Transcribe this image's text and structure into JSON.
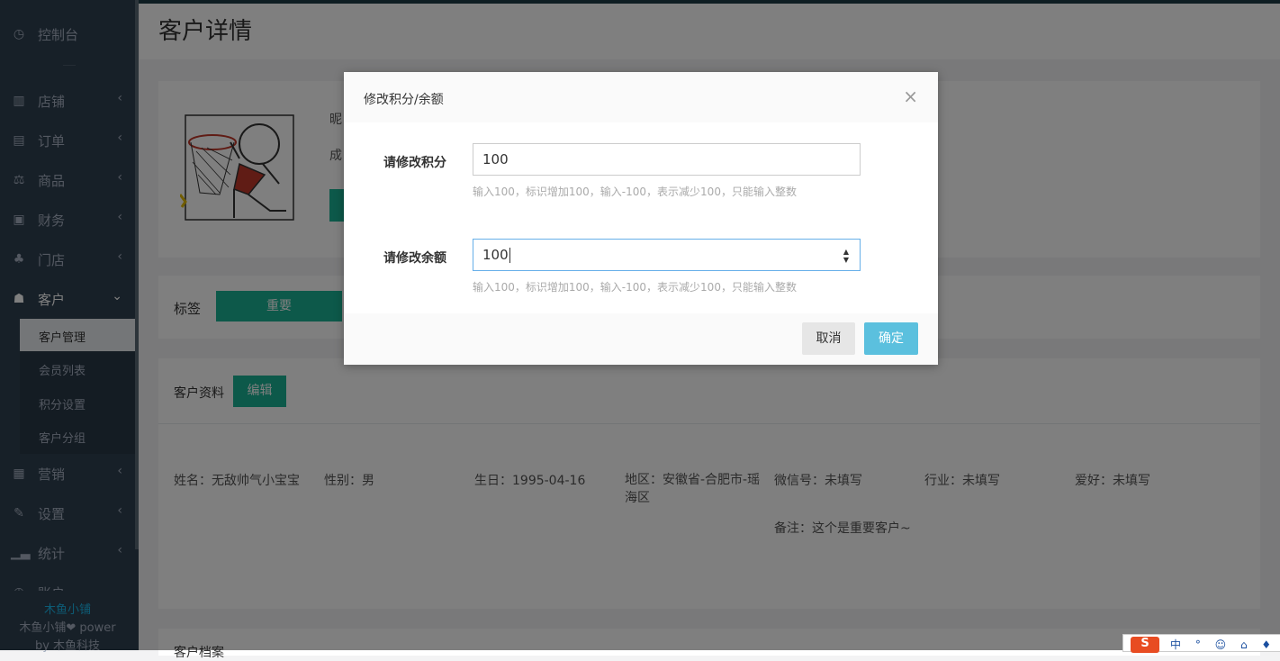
{
  "sidebar": {
    "dashboard": "控制台",
    "items": [
      {
        "label": "店铺",
        "icon": "shop-icon"
      },
      {
        "label": "订单",
        "icon": "order-icon"
      },
      {
        "label": "商品",
        "icon": "goods-icon"
      },
      {
        "label": "财务",
        "icon": "finance-icon"
      },
      {
        "label": "门店",
        "icon": "store-icon"
      },
      {
        "label": "客户",
        "icon": "users-icon"
      },
      {
        "label": "营销",
        "icon": "marketing-icon"
      },
      {
        "label": "设置",
        "icon": "wrench-icon"
      },
      {
        "label": "统计",
        "icon": "stats-icon"
      },
      {
        "label": "账户",
        "icon": "account-icon"
      }
    ],
    "subitems": [
      "客户管理",
      "会员列表",
      "积分设置",
      "客户分组"
    ],
    "brand_line1": "木鱼小铺",
    "brand_line2": "木鱼小铺❤ power",
    "brand_line3": "by 木鱼科技"
  },
  "page": {
    "title": "客户详情",
    "nickname_prefix": "昵",
    "growth_prefix": "成",
    "tag_label": "标签",
    "tag_button": "重要",
    "profile_label": "客户资料",
    "edit_button": "编辑",
    "fields": {
      "name": "姓名：无敌帅气小宝宝",
      "gender": "性别：男",
      "birthday": "生日：1995-04-16",
      "region": "地区：安徽省-合肥市-瑶海区",
      "wechat": "微信号：未填写",
      "industry": "行业：未填写",
      "hobby": "爱好：未填写",
      "remark": "备注：这个是重要客户~"
    },
    "bottom_section": "客户档案"
  },
  "modal": {
    "title": "修改积分/余额",
    "close": "×",
    "points_label": "请修改积分",
    "points_value": "100",
    "points_help": "输入100，标识增加100，输入-100，表示减少100，只能输入整数",
    "balance_label": "请修改余额",
    "balance_value": "100",
    "balance_help": "输入100，标识增加100，输入-100，表示减少100，只能输入整数",
    "cancel": "取消",
    "ok": "确定"
  },
  "ime": {
    "logo": "S",
    "mode": "中 ° ☺ ⌂ ♦"
  }
}
